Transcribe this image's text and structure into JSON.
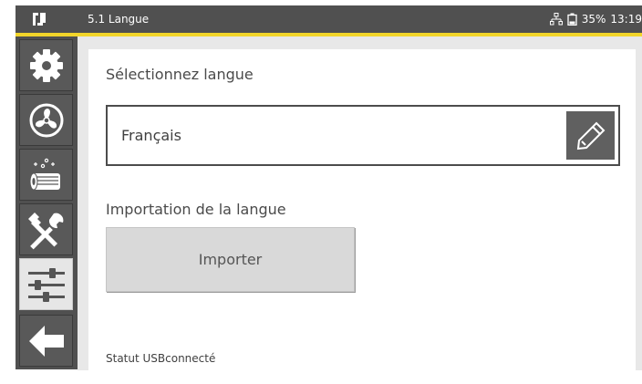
{
  "header": {
    "title": "5.1 Langue",
    "battery": "35%",
    "time": "13:19",
    "logo_icon": "brand-logo-icon",
    "network_icon": "network-icon",
    "battery_icon": "battery-icon",
    "accent_color": "#f2d52a"
  },
  "sidebar": {
    "items": [
      {
        "name": "settings",
        "icon": "gear-icon"
      },
      {
        "name": "fan",
        "icon": "fan-icon"
      },
      {
        "name": "filter",
        "icon": "filter-icon"
      },
      {
        "name": "tools",
        "icon": "tools-icon"
      },
      {
        "name": "adjustments",
        "icon": "sliders-icon",
        "active": true
      },
      {
        "name": "back",
        "icon": "back-arrow-icon"
      }
    ]
  },
  "main": {
    "select_language_label": "Sélectionnez langue",
    "selected_language": "Français",
    "edit_icon": "pencil-icon",
    "import_label": "Importation de la langue",
    "import_button": "Importer",
    "usb_status": "Statut USBconnecté"
  }
}
